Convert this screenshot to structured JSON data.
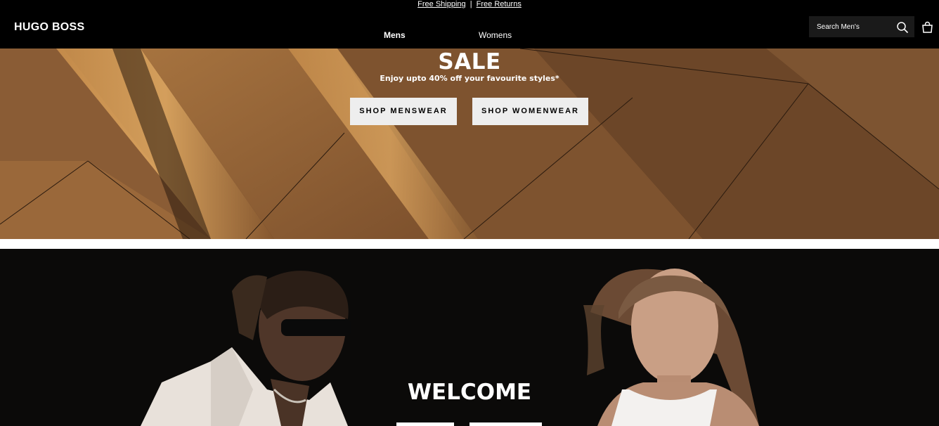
{
  "promo": {
    "shipping": "Free Shipping",
    "separator": "|",
    "returns": "Free Returns"
  },
  "header": {
    "logo": "HUGO BOSS",
    "nav": {
      "mens": "Mens",
      "womens": "Womens"
    },
    "search_placeholder": "Search Men's",
    "search_icon": "search-icon",
    "bag_icon": "bag-icon"
  },
  "sale": {
    "title": "SALE",
    "subtitle": "Enjoy upto 40% off your favourite styles*",
    "shop_menswear": "SHOP MENSWEAR",
    "shop_womenwear": "SHOP WOMENWEAR"
  },
  "welcome": {
    "title": "WELCOME"
  },
  "colors": {
    "background": "#000000",
    "sale_bronze": "#7a5230",
    "button_light": "#eeeeee"
  }
}
